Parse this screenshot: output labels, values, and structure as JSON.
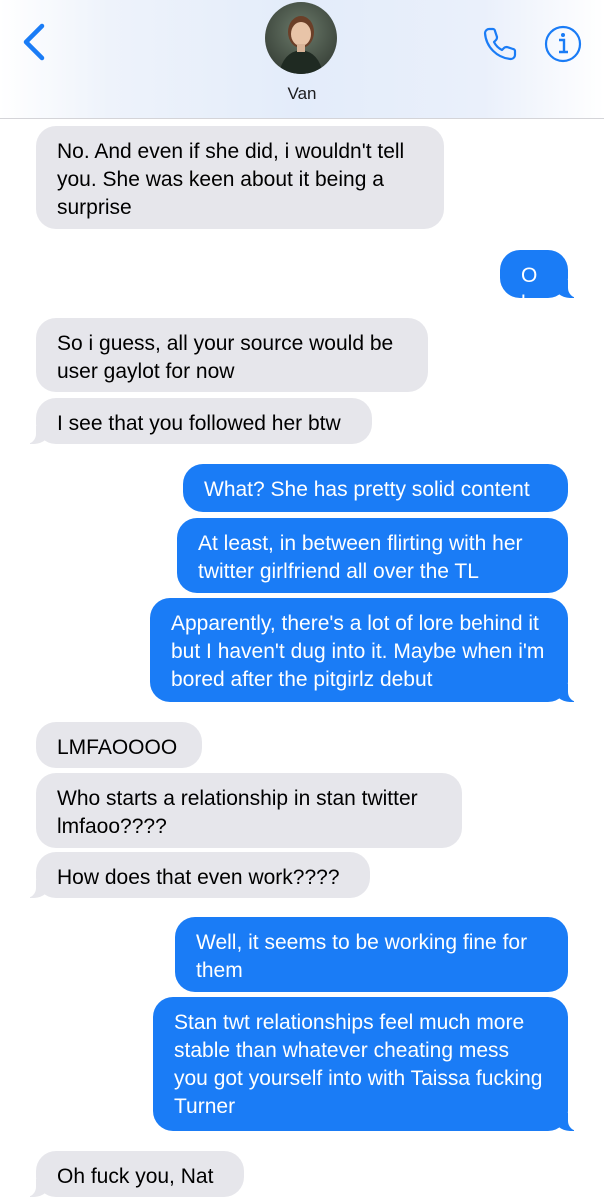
{
  "header": {
    "contact_name": "Van",
    "avatar_icon": "contact-photo",
    "back_icon": "chevron-left-icon",
    "call_icon": "phone-icon",
    "info_icon": "info-icon",
    "accent_color": "#1a7cf6"
  },
  "messages": [
    {
      "from": "them",
      "text": "No. And even if she did, i wouldn't tell you. She was keen about it being a surprise"
    },
    {
      "from": "me",
      "text": "Oh"
    },
    {
      "from": "them",
      "text": "So i guess, all your source would be user gaylot for now"
    },
    {
      "from": "them",
      "text": "I see that you followed her btw"
    },
    {
      "from": "me",
      "text": "What? She has pretty solid content"
    },
    {
      "from": "me",
      "text": "At least, in between flirting with her twitter girlfriend all over the TL"
    },
    {
      "from": "me",
      "text": "Apparently, there's a lot of lore behind it but I haven't dug into it. Maybe when i'm bored after the pitgirlz debut"
    },
    {
      "from": "them",
      "text": "LMFAOOOO"
    },
    {
      "from": "them",
      "text": "Who starts a relationship in stan twitter lmfaoo????"
    },
    {
      "from": "them",
      "text": "How does that even work????"
    },
    {
      "from": "me",
      "text": "Well, it seems to be working fine for them"
    },
    {
      "from": "me",
      "text": "Stan twt relationships feel much more stable than whatever cheating mess you got yourself into with Taissa fucking Turner"
    },
    {
      "from": "them",
      "text": "Oh fuck you, Nat"
    }
  ]
}
